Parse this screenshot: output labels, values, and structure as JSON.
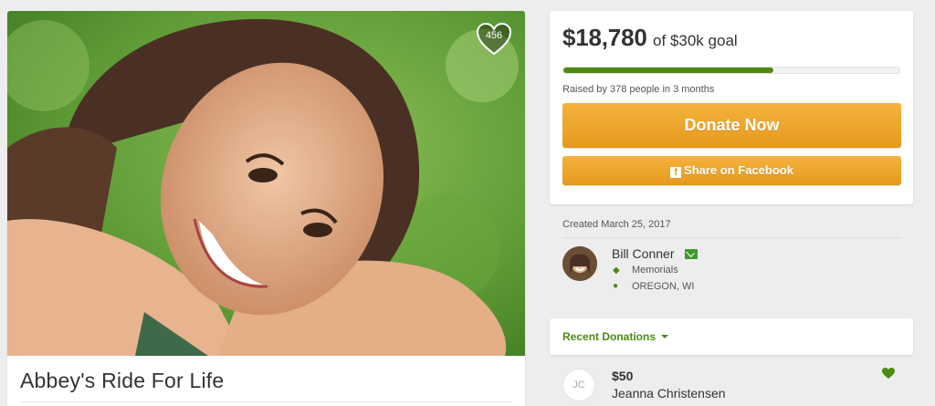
{
  "campaign": {
    "title": "Abbey's Ride For Life",
    "hearts": "456"
  },
  "goal": {
    "amount": "$18,780",
    "goal_text": "of $30k goal",
    "progress_fraction": 0.626,
    "raised_by": "Raised by 378 people in 3 months",
    "donate_label": "Donate Now",
    "share_label": "Share on Facebook"
  },
  "organizer": {
    "created": "Created March 25, 2017",
    "name": "Bill Conner",
    "category": "Memorials",
    "location": "OREGON, WI"
  },
  "donations": {
    "section_label": "Recent Donations",
    "items": [
      {
        "initials": "JC",
        "amount": "$50",
        "name": "Jeanna Christensen"
      }
    ]
  },
  "colors": {
    "accent_green": "#4d8a12",
    "button_orange": "#e8a025"
  },
  "icons": [
    "heart-icon",
    "facebook-icon",
    "mail-icon",
    "tag-icon",
    "map-pin-icon",
    "caret-down-icon"
  ]
}
